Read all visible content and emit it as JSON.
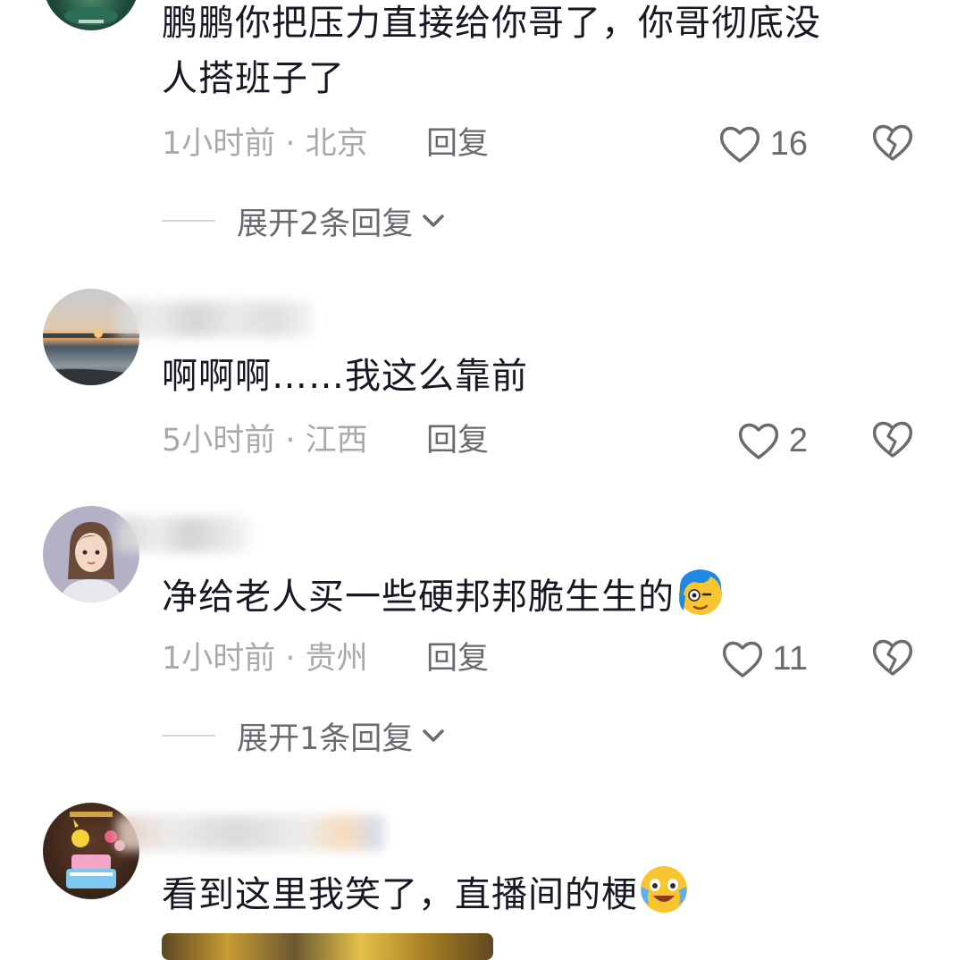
{
  "comments": [
    {
      "text": "鹏鹏你把压力直接给你哥了，你哥彻底没人搭班子了",
      "text_line1": "鹏鹏你把压力直接给你哥了，你哥彻底没",
      "text_line2": "人搭班子了",
      "meta": "1小时前 · 北京",
      "reply_label": "回复",
      "likes": "16",
      "expand_label": "展开2条回复"
    },
    {
      "text": "啊啊啊……我这么靠前",
      "meta": "5小时前 · 江西",
      "reply_label": "回复",
      "likes": "2"
    },
    {
      "text": "净给老人买一些硬邦邦脆生生的",
      "emoji": "anime-face-emoji",
      "meta": "1小时前 · 贵州",
      "reply_label": "回复",
      "likes": "11",
      "expand_label": "展开1条回复"
    },
    {
      "text": "看到这里我笑了，直播间的梗",
      "emoji": "crying-laughing-emoji"
    }
  ],
  "icons": {
    "like": "heart-outline-icon",
    "dislike": "broken-heart-icon",
    "expand": "chevron-down-icon"
  },
  "colors": {
    "primary_text": "#161823",
    "meta_text": "#a8a9ad",
    "action_text": "#6a6b70"
  }
}
